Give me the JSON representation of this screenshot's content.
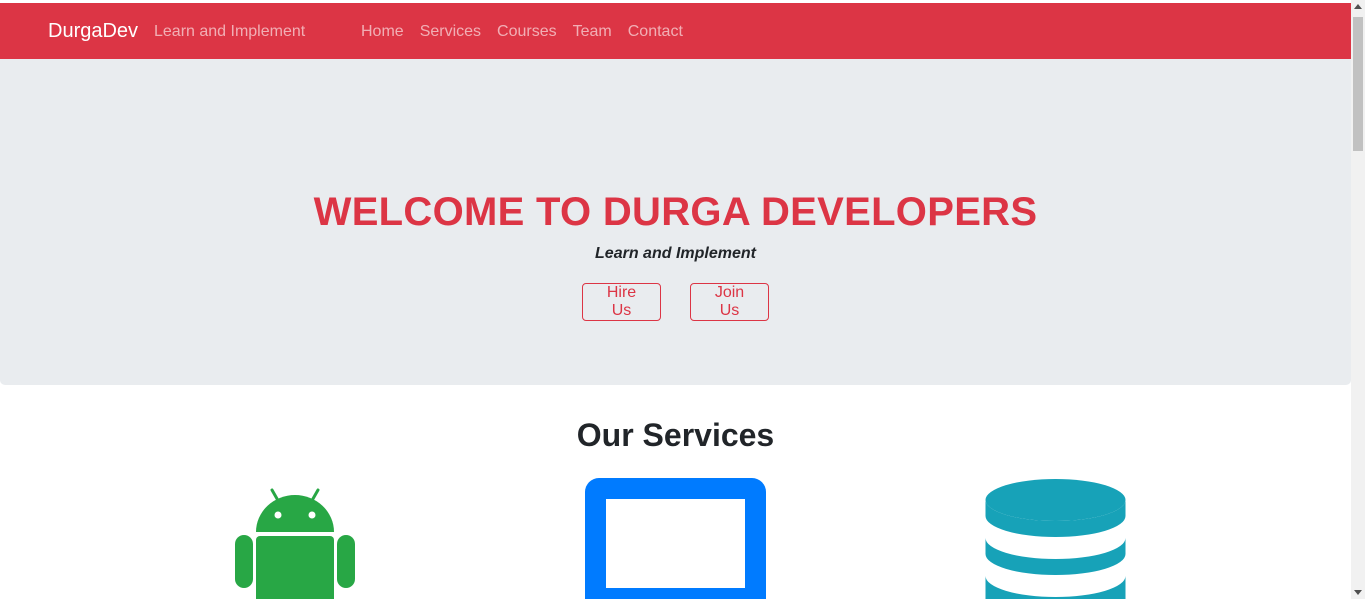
{
  "navbar": {
    "brand": "DurgaDev",
    "tagline": "Learn and Implement",
    "links": [
      "Home",
      "Services",
      "Courses",
      "Team",
      "Contact"
    ],
    "background_color": "#dc3545"
  },
  "hero": {
    "title": "WELCOME TO DURGA DEVELOPERS",
    "subtitle": "Learn and Implement",
    "buttons": {
      "hire": "Hire Us",
      "join": "Join Us"
    },
    "background_color": "#e9ecef",
    "accent_color": "#dc3545"
  },
  "services": {
    "title": "Our Services",
    "icons": [
      {
        "name": "android-icon",
        "color": "#28a745"
      },
      {
        "name": "tablet-icon",
        "color": "#007bff"
      },
      {
        "name": "database-icon",
        "color": "#17a2b8"
      }
    ]
  }
}
